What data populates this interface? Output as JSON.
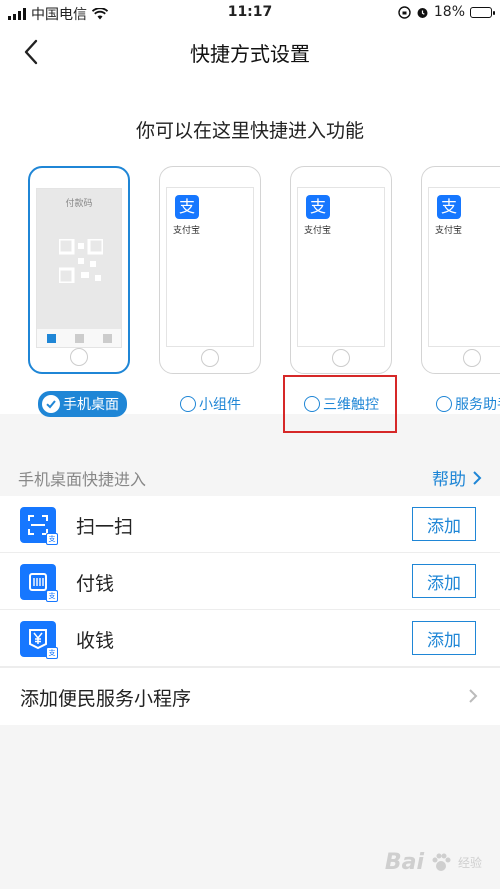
{
  "status_bar": {
    "carrier": "中国电信",
    "time": "11:17",
    "battery_percent": "18%",
    "battery_level": 0.18
  },
  "nav": {
    "title": "快捷方式设置",
    "back_icon": "chevron-left-icon"
  },
  "intro_text": "你可以在这里快捷进入功能",
  "previews": {
    "desktop_screen_title": "付款码",
    "alipay_label": "支付宝",
    "alipay_logo_char": "支"
  },
  "options": [
    {
      "label": "手机桌面",
      "selected": true
    },
    {
      "label": "小组件",
      "selected": false
    },
    {
      "label": "三维触控",
      "selected": false
    },
    {
      "label": "服务助手",
      "selected": false
    }
  ],
  "section": {
    "title": "手机桌面快捷进入",
    "help": "帮助"
  },
  "shortcuts": [
    {
      "label": "扫一扫",
      "button": "添加",
      "icon": "scan-icon"
    },
    {
      "label": "付钱",
      "button": "添加",
      "icon": "barcode-icon"
    },
    {
      "label": "收钱",
      "button": "添加",
      "icon": "yen-icon"
    }
  ],
  "mini_program_row": {
    "label": "添加便民服务小程序"
  },
  "watermark": {
    "text": "Bai",
    "suffix": "经验"
  },
  "colors": {
    "accent": "#1f86d6",
    "alipay_blue": "#1677ff",
    "highlight_red": "#d62828"
  }
}
